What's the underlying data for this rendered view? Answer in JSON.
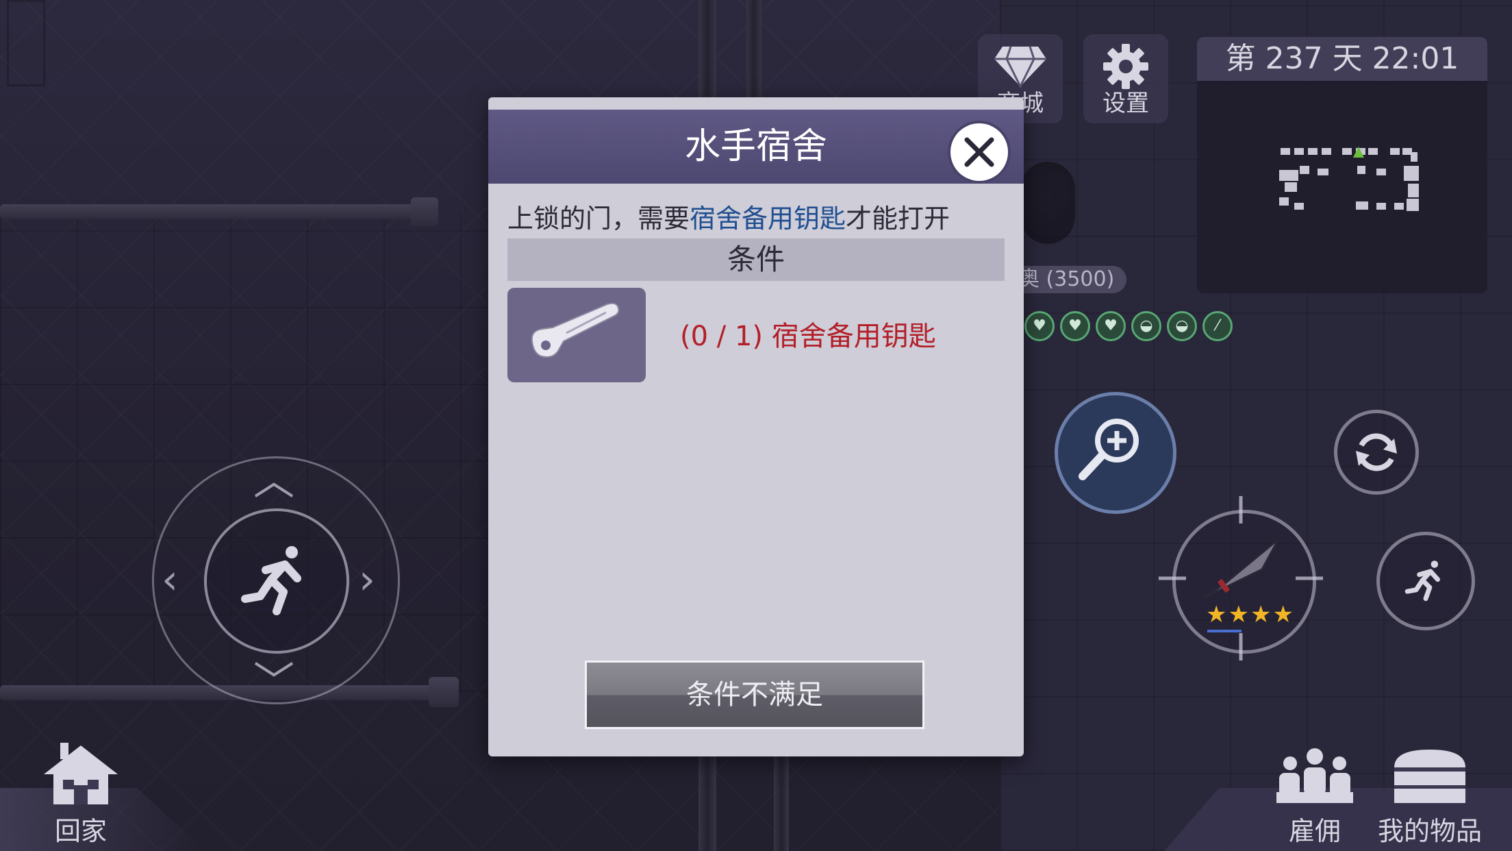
{
  "hud": {
    "shop_label": "商城",
    "settings_label": "设置",
    "day_time": "第 237 天  22:01"
  },
  "world": {
    "npc_tag": "奥 (3500)"
  },
  "weapon": {
    "stars": 4
  },
  "bottom": {
    "home_label": "回家",
    "hire_label": "雇佣",
    "items_label": "我的物品"
  },
  "modal": {
    "title": "水手宿舍",
    "desc_before": "上锁的门，需要",
    "desc_highlight": "宿舍备用钥匙",
    "desc_after": "才能打开",
    "condition_header": "条件",
    "requirement_text": "(0 / 1) 宿舍备用钥匙",
    "button_label": "条件不满足"
  },
  "colors": {
    "header": "#5f5985",
    "requirement": "#b31f28",
    "highlight": "#1f4f91"
  }
}
